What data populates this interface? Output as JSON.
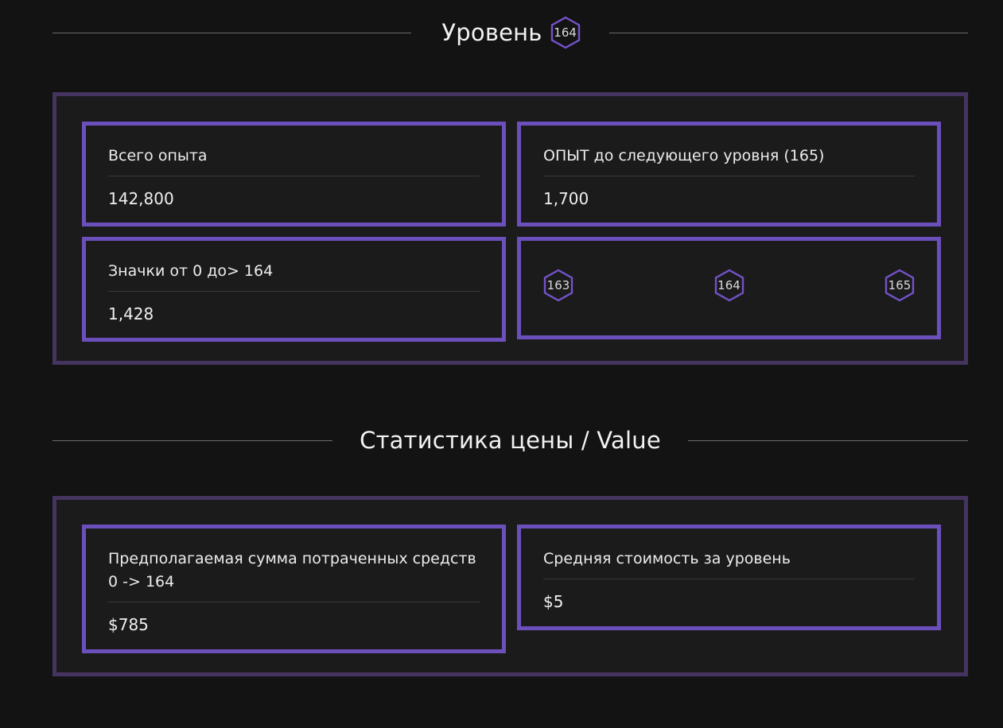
{
  "level_section": {
    "title": "Уровень",
    "level_badge": "164",
    "cards": {
      "total_xp": {
        "label": "Всего опыта",
        "value": "142,800"
      },
      "xp_to_next": {
        "label": "ОПЫТ до следующего уровня (165)",
        "value": "1,700"
      },
      "badges": {
        "label": "Значки от 0 до> 164",
        "value": "1,428"
      }
    },
    "level_progression": [
      "163",
      "164",
      "165"
    ]
  },
  "price_section": {
    "title": "Статистика цены / Value",
    "cards": {
      "estimated_spent": {
        "label": "Предполагаемая сумма потраченных средств 0 -> 164",
        "value": "$785"
      },
      "avg_cost_per_level": {
        "label": "Средняя стоимость за уровень",
        "value": "$5"
      }
    }
  },
  "colors": {
    "background": "#131313",
    "panel_border": "#44345f",
    "card_border": "#6b4fbb",
    "hex_stroke": "#7353c9"
  },
  "icons": {
    "level_badge": "hexagon-level-icon"
  }
}
